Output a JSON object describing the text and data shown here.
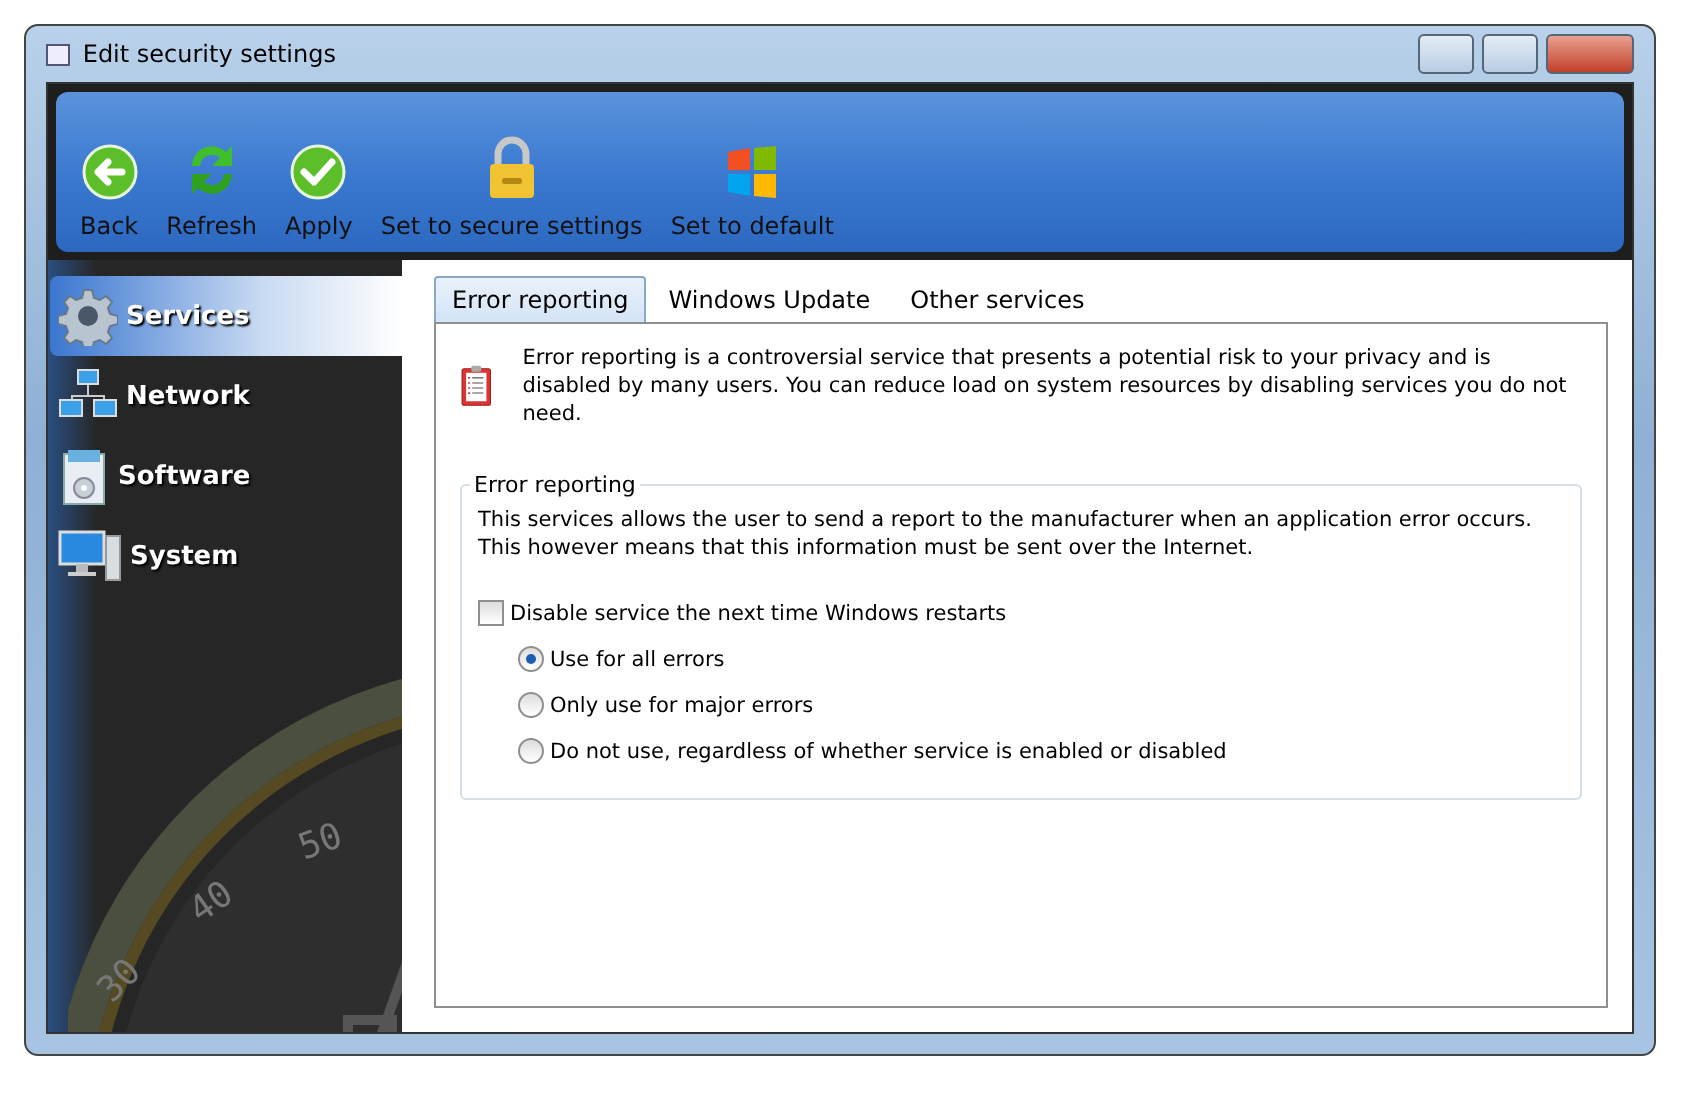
{
  "window": {
    "title": "Edit security settings"
  },
  "toolbar": [
    {
      "kind": "back",
      "label": "Back"
    },
    {
      "kind": "refresh",
      "label": "Refresh"
    },
    {
      "kind": "apply",
      "label": "Apply"
    },
    {
      "kind": "lock",
      "label": "Set to secure settings"
    },
    {
      "kind": "windows",
      "label": "Set to default"
    }
  ],
  "sidebar": {
    "items": [
      {
        "kind": "services",
        "label": "Services",
        "selected": true
      },
      {
        "kind": "network",
        "label": "Network",
        "selected": false
      },
      {
        "kind": "software",
        "label": "Software",
        "selected": false
      },
      {
        "kind": "system",
        "label": "System",
        "selected": false
      }
    ],
    "gauge_labels": [
      "50",
      "40",
      "30"
    ]
  },
  "tabs": [
    {
      "label": "Error reporting",
      "selected": true
    },
    {
      "label": "Windows Update",
      "selected": false
    },
    {
      "label": "Other services",
      "selected": false
    }
  ],
  "intro": "Error reporting is a controversial service that presents a potential risk to your privacy and is disabled by many users. You can reduce load on system resources by disabling services you do not need.",
  "group": {
    "title": "Error reporting",
    "description": "This services allows the user to send a report to the manufacturer when an application error occurs. This however means that this information must be sent over the Internet.",
    "checkbox": {
      "label": "Disable service the next time Windows restarts",
      "checked": false
    },
    "options": [
      {
        "label": "Use for all errors",
        "selected": true
      },
      {
        "label": "Only use for major errors",
        "selected": false
      },
      {
        "label": "Do not use, regardless of whether service is enabled or disabled",
        "selected": false
      }
    ]
  }
}
